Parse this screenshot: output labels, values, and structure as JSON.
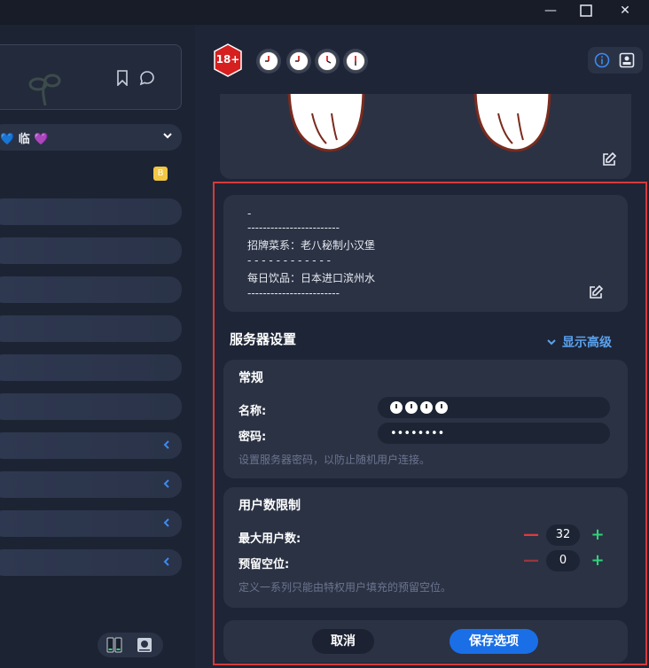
{
  "window": {
    "minimize_glyph": "—",
    "maximize_glyph": "☐",
    "close_glyph": "✕"
  },
  "left": {
    "select_text": "💙 临 💜",
    "badge_text": "B"
  },
  "header": {
    "age_badge_text": "18+"
  },
  "description": {
    "lines": [
      "-",
      "------------------------",
      "招牌菜系：老八秘制小汉堡",
      "- - - - - - - - - - - -",
      "每日饮品：日本进口滨州水",
      "------------------------"
    ]
  },
  "server_settings": {
    "title": "服务器设置",
    "advanced_label": "显示高级"
  },
  "general": {
    "title": "常规",
    "name_label": "名称:",
    "password_label": "密码:",
    "password_value": "••••••••",
    "hint": "设置服务器密码，以防止随机用户连接。"
  },
  "limits": {
    "title": "用户数限制",
    "max_users_label": "最大用户数:",
    "max_users_value": "32",
    "reserved_label": "预留空位:",
    "reserved_value": "0",
    "hint": "定义一系列只能由特权用户填充的预留空位。",
    "minus_glyph": "—",
    "plus_glyph": "+"
  },
  "footer": {
    "cancel_label": "取消",
    "save_label": "保存选项"
  },
  "colors": {
    "highlight_border": "#d63a3a",
    "accent_blue": "#1a6fe6",
    "link_blue": "#5aa2ee",
    "minus_red": "#e23a3a",
    "plus_green": "#2fd278"
  }
}
